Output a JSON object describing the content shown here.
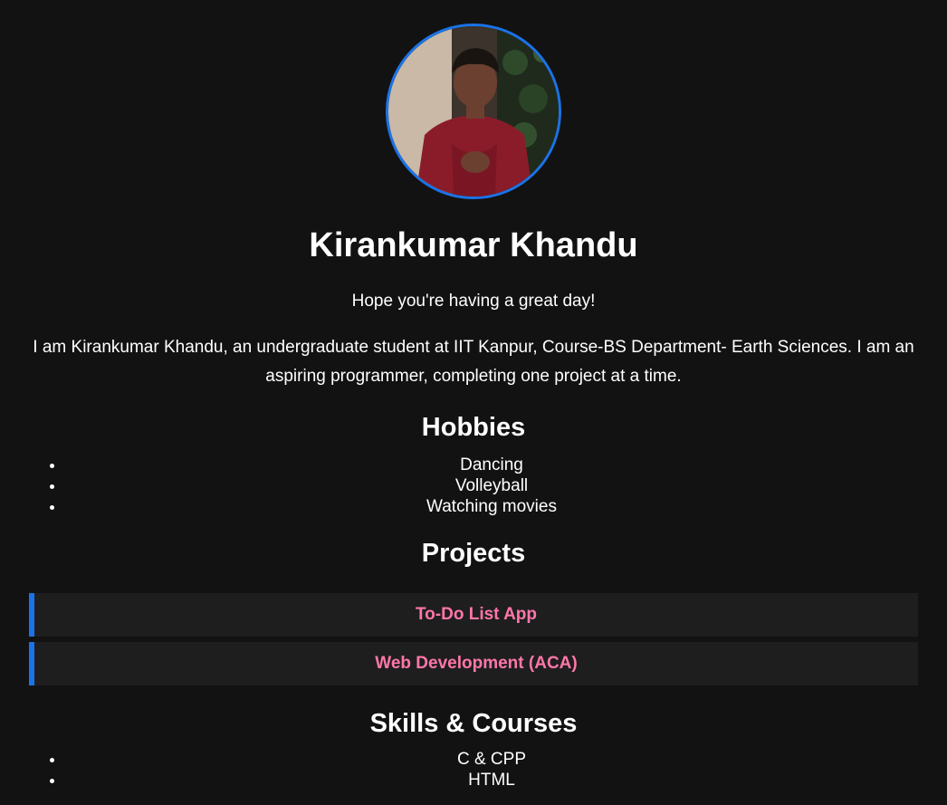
{
  "profile": {
    "name": "Kirankumar Khandu",
    "tagline": "Hope you're having a great day!",
    "bio": "I am Kirankumar Khandu, an undergraduate student at IIT Kanpur, Course-BS Department- Earth Sciences. I am an aspiring programmer, completing one project at a time."
  },
  "hobbies": {
    "heading": "Hobbies",
    "items": [
      "Dancing",
      "Volleyball",
      "Watching movies"
    ]
  },
  "projects": {
    "heading": "Projects",
    "items": [
      "To-Do List App",
      "Web Development (ACA)"
    ]
  },
  "skills": {
    "heading": "Skills & Courses",
    "items": [
      "C & CPP",
      "HTML"
    ]
  },
  "colors": {
    "background": "#121212",
    "accent": "#1a73e8",
    "link": "#ff77a9",
    "card": "#1e1e1e"
  }
}
